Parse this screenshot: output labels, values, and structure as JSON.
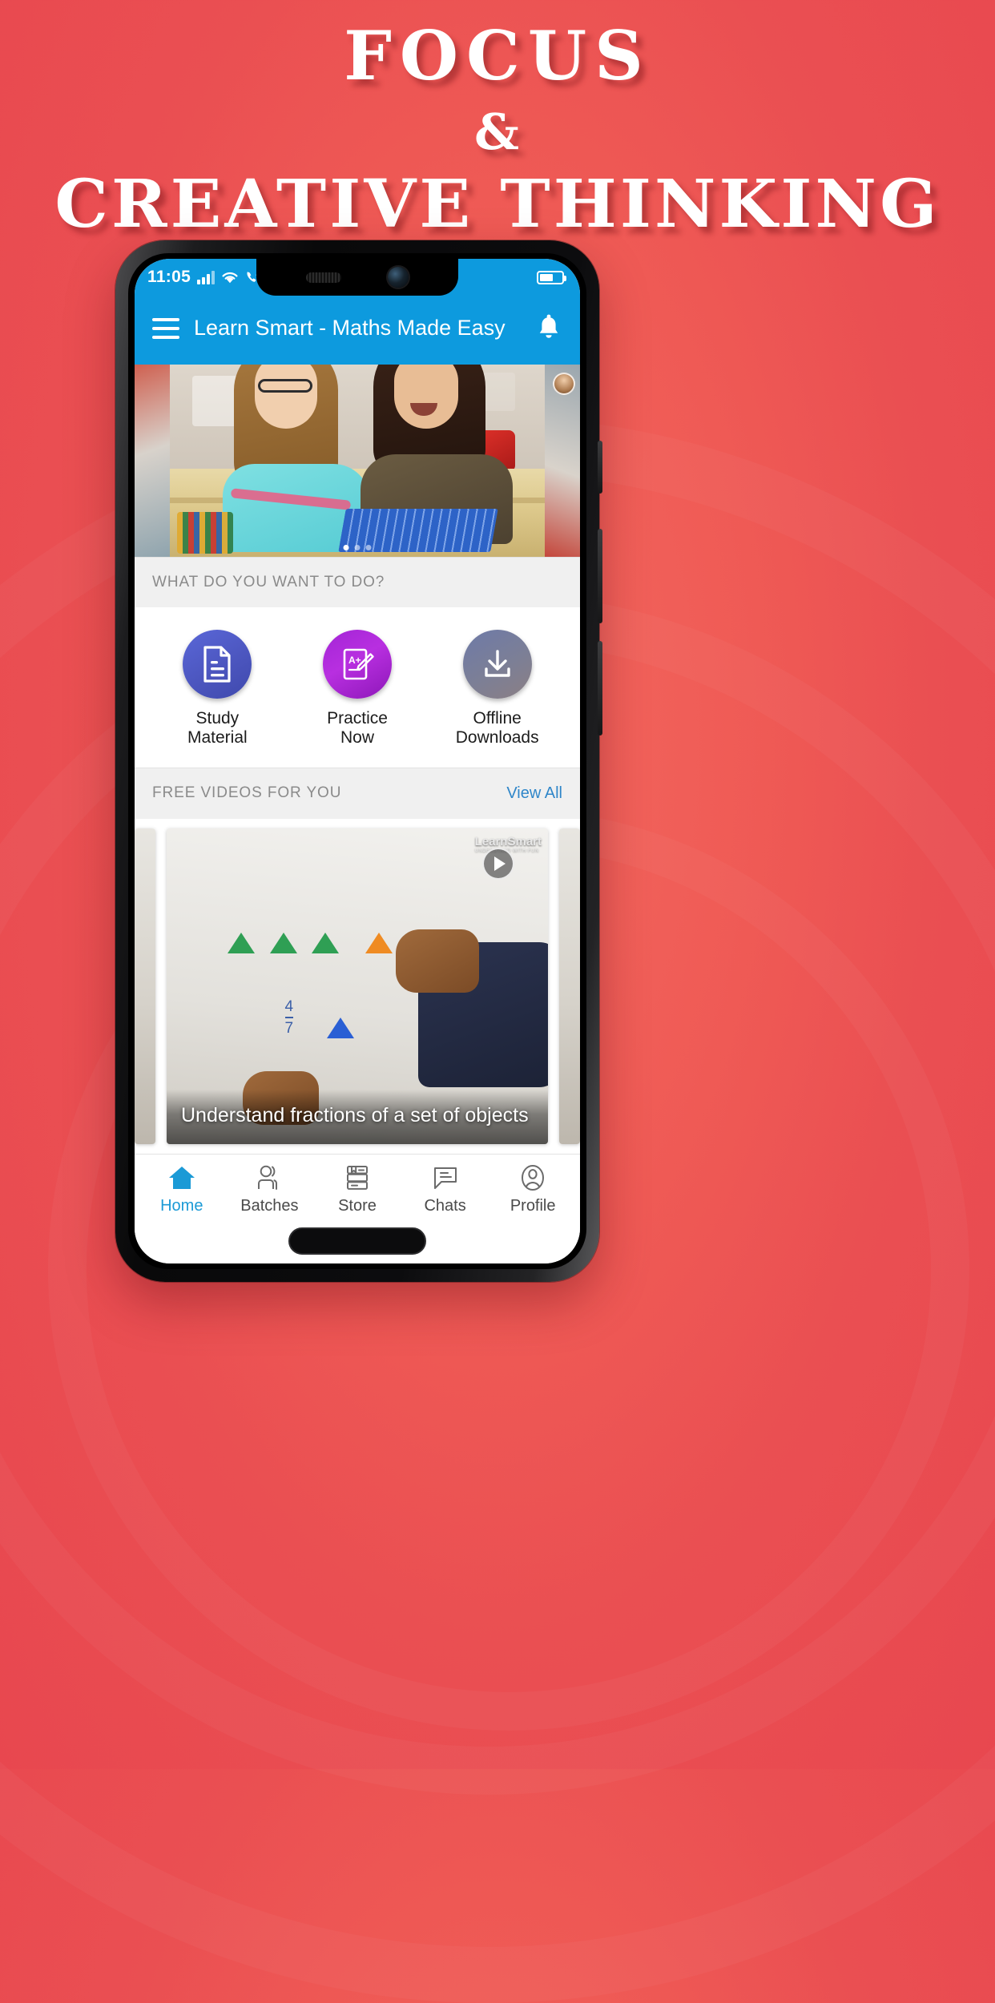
{
  "promo": {
    "line1": "FOCUS",
    "line2": "&",
    "line3": "CREATIVE THINKING",
    "background_color": "#ef5a55",
    "text_color": "#ffffff"
  },
  "device": {
    "status_bar": {
      "time": "11:05",
      "signal_icon": "signal-bars-icon",
      "wifi_icon": "wifi-icon",
      "call_icon": "phone-call-icon",
      "battery_icon": "battery-icon",
      "background_color": "#0d9ade"
    },
    "home_indicator": "home-pill"
  },
  "app_bar": {
    "menu_icon": "hamburger-menu-icon",
    "title": "Learn Smart - Maths Made Easy",
    "notification_icon": "bell-icon",
    "background_color": "#0d9ade"
  },
  "hero": {
    "alt": "Two girls working with a blue math manipulative grid at a classroom desk",
    "avatar_badge": "user-avatar",
    "dots": 3,
    "active_dot": 1
  },
  "actions_section": {
    "heading": "WHAT DO YOU WANT TO DO?",
    "items": [
      {
        "label_line1": "Study",
        "label_line2": "Material",
        "icon": "document-icon",
        "color": "#4c56bf"
      },
      {
        "label_line1": "Practice",
        "label_line2": "Now",
        "icon": "grade-paper-pencil-icon",
        "color": "#b82fe0"
      },
      {
        "label_line1": "Offline",
        "label_line2": "Downloads",
        "icon": "download-icon",
        "color": "#7c7f96"
      }
    ]
  },
  "videos_section": {
    "heading": "FREE VIDEOS FOR YOU",
    "view_all": "View All",
    "view_all_color": "#2f86c9",
    "cards": [
      {
        "title": "Understand fractions of a set of objects",
        "watermark": "LearnSmart",
        "watermark_sub": "UNDERSTAND WITH FUN",
        "play_icon": "play-button-icon",
        "fraction_label": "4/7"
      }
    ]
  },
  "bottom_nav": {
    "active_color": "#1b9ad6",
    "items": [
      {
        "label": "Home",
        "icon": "home-icon",
        "active": true
      },
      {
        "label": "Batches",
        "icon": "people-icon",
        "active": false
      },
      {
        "label": "Store",
        "icon": "books-icon",
        "active": false
      },
      {
        "label": "Chats",
        "icon": "chat-bubble-icon",
        "active": false
      },
      {
        "label": "Profile",
        "icon": "person-circle-icon",
        "active": false
      }
    ]
  }
}
